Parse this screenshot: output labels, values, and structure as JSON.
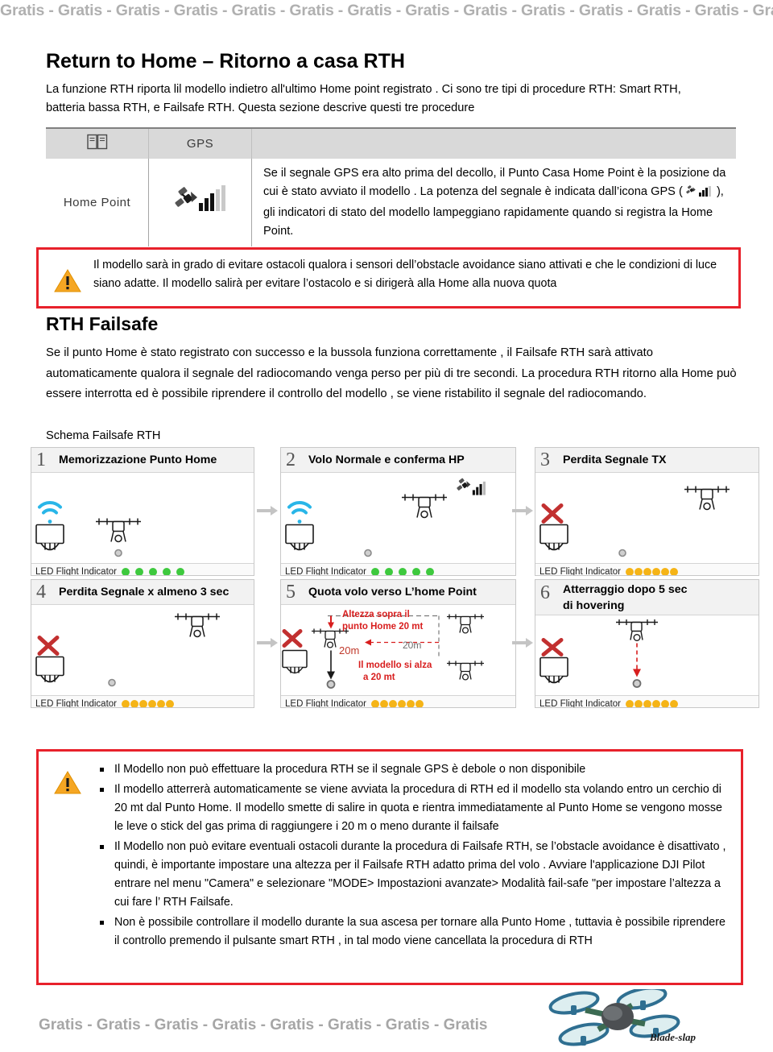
{
  "watermark": {
    "header": "Gratis - Gratis - Gratis - Gratis - Gratis - Gratis - Gratis - Gratis - Gratis - Gratis - Gratis - Gratis - Gratis - Gratis",
    "footer": "Gratis - Gratis - Gratis - Gratis - Gratis - Gratis - Gratis - Gratis"
  },
  "heading": "Return to Home – Ritorno a casa  RTH",
  "intro": "La funzione RTH riporta lil modello  indietro all'ultimo Home point registrato . Ci sono tre tipi di procedure RTH: Smart RTH, batteria bassa RTH, e Failsafe RTH. Questa sezione descrive questi tre procedure",
  "gps_table": {
    "header": {
      "book_icon": "book-icon",
      "gps_label": "GPS",
      "blank": ""
    },
    "row": {
      "label": "Home Point",
      "icon": "gps-satellite-signal-icon",
      "text_part1": "Se il segnale GPS era alto prima del decollo, il Punto Casa Home Point è la posizione da cui è stato avviato il modello . La potenza del segnale è indicata dall’icona  GPS ( ",
      "text_part2": " ), gli indicatori di stato del modello lampeggiano rapidamente quando si registra la Home Point."
    }
  },
  "warning_top": {
    "icon": "warning-triangle-icon",
    "text": "Il modello sarà in grado di evitare ostacoli qualora i sensori dell’obstacle avoidance siano attivati e che le condizioni di luce siano adatte. Il modello salirà per evitare l’ostacolo e si dirigerà alla Home alla nuova quota"
  },
  "section": {
    "title": "RTH  Failsafe",
    "paragraph": "Se il punto Home è stato registrato con successo e la bussola funziona correttamente , il Failsafe RTH sarà attivato automaticamente qualora il segnale del radiocomando venga perso per più di tre secondi. La procedura RTH ritorno  alla  Home  può essere interrotta  ed è possibile riprendere il controllo del modello , se viene ristabilito il  segnale del radiocomando.",
    "schema_label": "Schema Failsafe RTH"
  },
  "diagram": {
    "led_label": "LED Flight Indicator",
    "colors": {
      "green": "#3ec93e",
      "amber": "#f5b417",
      "red": "#d81e1e",
      "wifi_blue": "#29b6e8",
      "arrow_gray": "#c0c0c0"
    },
    "panels": [
      {
        "num": "1",
        "title": "Memorizzazione Punto Home",
        "led_color": "green",
        "led_count": 5,
        "led_spacing": "wide"
      },
      {
        "num": "2",
        "title": "Volo Normale e conferma HP",
        "led_color": "green",
        "led_count": 5,
        "led_spacing": "wide"
      },
      {
        "num": "3",
        "title": "Perdita Segnale TX",
        "led_color": "amber",
        "led_count": 6,
        "led_spacing": "tight"
      },
      {
        "num": "4",
        "title": "Perdita Segnale x almeno 3 sec",
        "led_color": "amber",
        "led_count": 6,
        "led_spacing": "tight"
      },
      {
        "num": "5",
        "title": "Quota volo verso L’home Point",
        "led_color": "amber",
        "led_count": 6,
        "led_spacing": "tight"
      },
      {
        "num": "6",
        "title": "Atterraggio dopo 5 sec di hovering",
        "title_line1": "Atterraggio dopo 5 sec",
        "title_line2": "di hovering",
        "led_color": "amber",
        "led_count": 6,
        "led_spacing": "tight"
      }
    ],
    "panel5_annotations": {
      "altitude_note_line1": "Altezza sopra il",
      "altitude_note_line2": "punto Home 20 mt",
      "climb_note_line1": "Il modello si alza",
      "climb_note_line2": "a 20 mt",
      "vertical_measure": "20m",
      "horizontal_measure": "20m"
    }
  },
  "warning_bottom": {
    "icon": "warning-triangle-icon",
    "bullets": [
      "Il Modello non può effettuare la procedura RTH se il segnale GPS è debole  o non disponibile",
      "Il modello atterrerà automaticamente  se viene avviata la procedura di RTH ed il modello sta volando entro un cerchio di 20 mt dal Punto Home. Il modello smette di salire in quota e  rientra immediatamente  al Punto Home se vengono mosse le leve o stick del gas  prima di raggiungere i 20 m o meno durante il failsafe",
      "Il Modello non può evitare eventuali ostacoli durante la procedura di Failsafe RTH, se l’obstacle avoidance è disattivato , quindi, è importante impostare una altezza per il  Failsafe RTH adatto prima del volo . Avviare l'applicazione DJI Pilot entrare nel menu \"Camera\" e selezionare \"MODE> Impostazioni avanzate> Modalità fail-safe \"per impostare  l’altezza a cui fare l’ RTH Failsafe.",
      "Non è possibile controllare il modello  durante la sua ascesa per tornare alla Punto Home , tuttavia è possibile riprendere il controllo premendo il pulsante smart RTH , in tal modo viene cancellata la procedura di RTH"
    ]
  },
  "logo": {
    "name": "Blade-slap",
    "icon": "quadcopter-logo-icon"
  }
}
